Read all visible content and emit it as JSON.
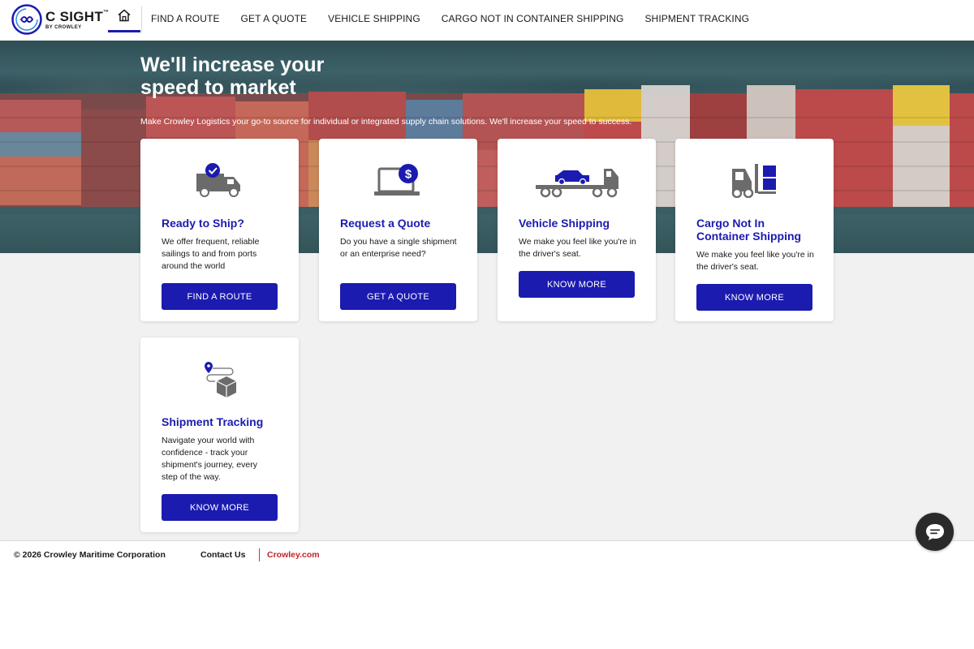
{
  "brand": {
    "title": "C SIGHT",
    "tm": "™",
    "subtitle": "BY CROWLEY",
    "primary_color": "#1b1bb0",
    "accent_color": "#c0222a"
  },
  "nav": {
    "home_icon": "home-icon",
    "items": [
      {
        "label": "FIND A ROUTE"
      },
      {
        "label": "GET A QUOTE"
      },
      {
        "label": "VEHICLE SHIPPING"
      },
      {
        "label": "CARGO NOT IN CONTAINER SHIPPING"
      },
      {
        "label": "SHIPMENT TRACKING"
      }
    ]
  },
  "hero": {
    "title": "We'll increase your speed to market",
    "subtitle": "Make Crowley Logistics your go-to source for individual or integrated supply chain solutions. We'll increase your speed to success."
  },
  "cards": [
    {
      "icon": "truck-check-icon",
      "title": "Ready to Ship?",
      "description": "We offer frequent, reliable sailings to and from ports around the world",
      "button": "FIND A ROUTE"
    },
    {
      "icon": "laptop-dollar-icon",
      "title": "Request a Quote",
      "description": "Do you have a single shipment or an enterprise need?",
      "button": "GET A QUOTE"
    },
    {
      "icon": "car-carrier-icon",
      "title": "Vehicle Shipping",
      "description": "We make you feel like you're in the driver's seat.",
      "button": "KNOW MORE"
    },
    {
      "icon": "forklift-icon",
      "title": "Cargo Not In Container Shipping",
      "description": "We make you feel like you're in the driver's seat.",
      "button": "KNOW MORE"
    },
    {
      "icon": "package-tracking-icon",
      "title": "Shipment Tracking",
      "description": "Navigate your world with confidence - track your shipment's journey, every step of the way.",
      "button": "KNOW MORE"
    }
  ],
  "footer": {
    "copyright": "© 2026 Crowley Maritime Corporation",
    "contact": "Contact Us",
    "link": "Crowley.com"
  },
  "chat": {
    "icon": "chat-bubble-icon"
  }
}
